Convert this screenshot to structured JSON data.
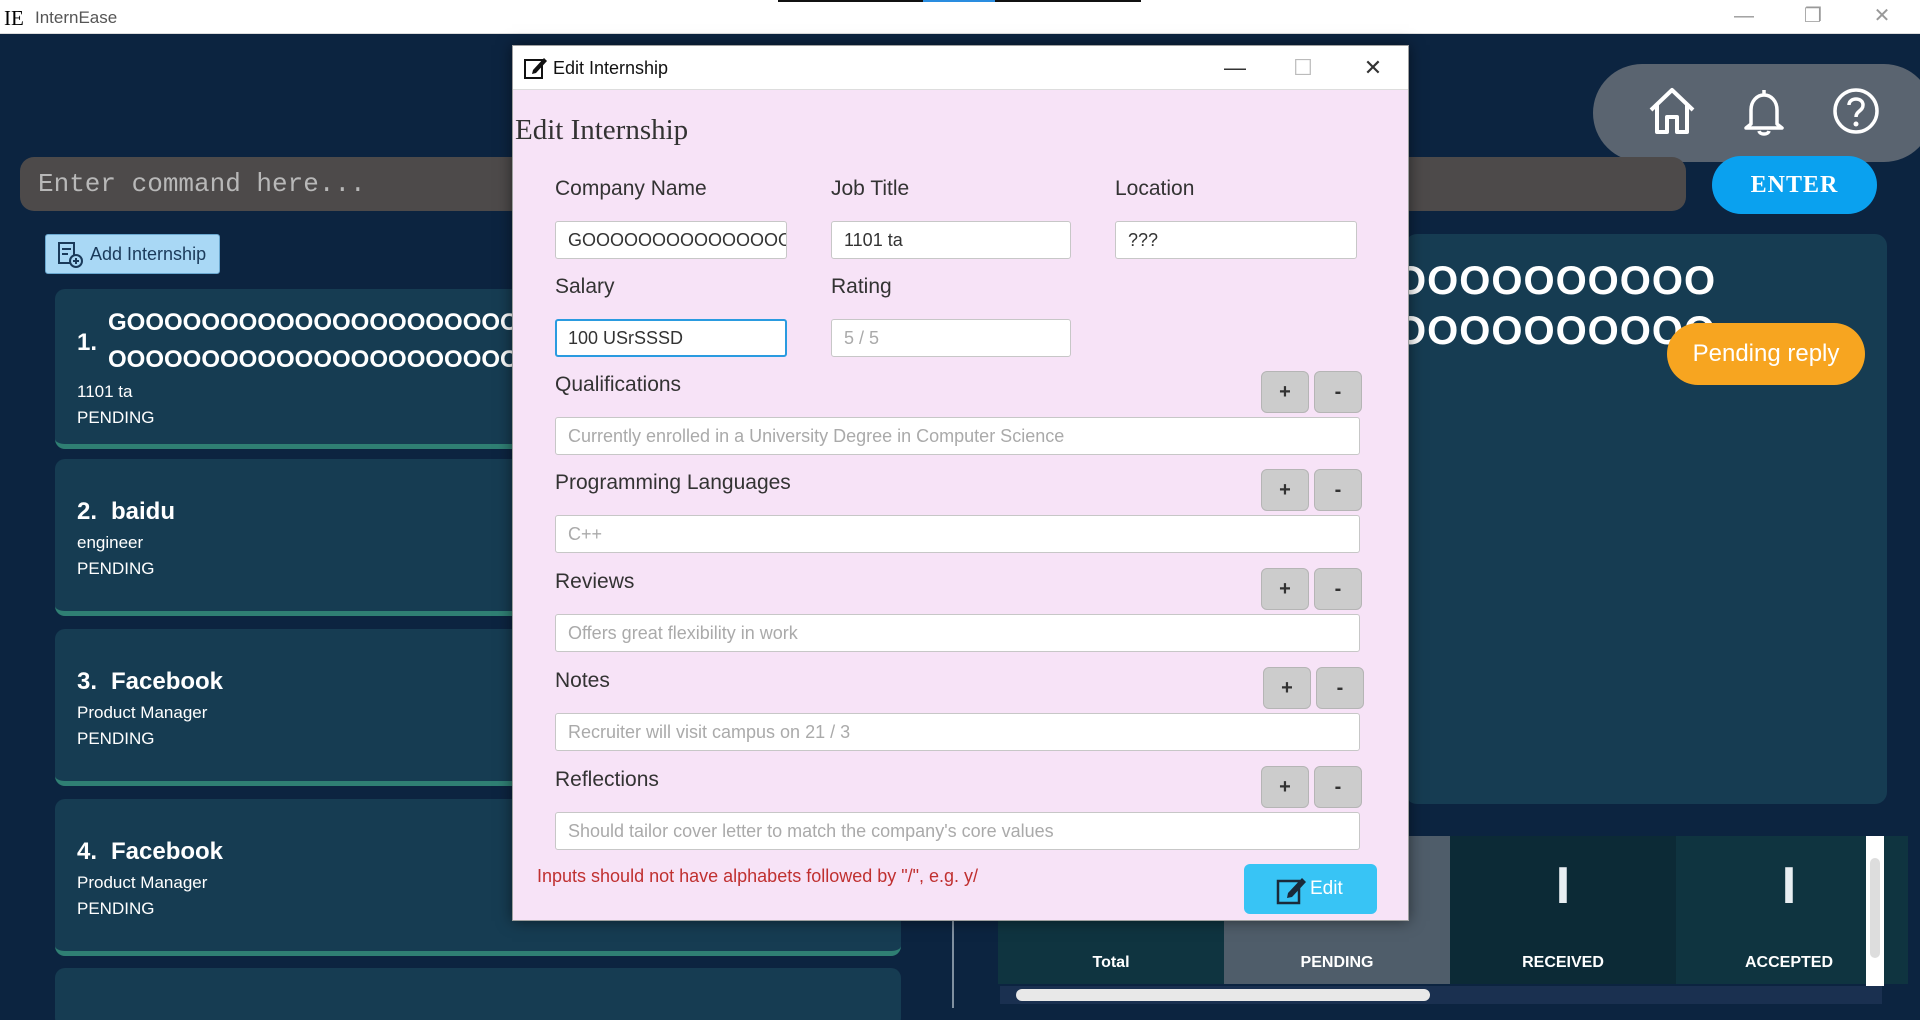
{
  "app": {
    "logo": "IE",
    "title": "InternEase"
  },
  "command": {
    "placeholder": "Enter command here...",
    "enter_label": "ENTER"
  },
  "nav": {
    "icons": [
      "home-icon",
      "bell-icon",
      "help-icon"
    ]
  },
  "add_button": {
    "label": "Add Internship"
  },
  "internships": [
    {
      "index": "1.",
      "company_line1": "GOOOOOOOOOOOOOOOOOOOOOOO",
      "company_line2": "OOOOOOOOOOOOOOOOOOOOOOOO",
      "title": "1101 ta",
      "status": "PENDING"
    },
    {
      "index": "2.",
      "company": "baidu",
      "title": "engineer",
      "status": "PENDING"
    },
    {
      "index": "3.",
      "company": "Facebook",
      "title": "Product  Manager",
      "status": "PENDING"
    },
    {
      "index": "4.",
      "company": "Facebook",
      "title": "Product Manager",
      "status": "PENDING"
    }
  ],
  "detail": {
    "company_line1": "OOOOOOOOOO",
    "company_line2": "OOOOOOOOOO",
    "status_badge": "Pending reply"
  },
  "stats": [
    {
      "label": "Total",
      "value": ""
    },
    {
      "label": "PENDING",
      "value": ""
    },
    {
      "label": "RECEIVED",
      "value": "I"
    },
    {
      "label": "ACCEPTED",
      "value": "I"
    }
  ],
  "dialog": {
    "window_title": "Edit Internship",
    "heading": "Edit Internship",
    "company_name": {
      "label": "Company Name",
      "value": "GOOOOOOOOOOOOOOOOOOOOOOO"
    },
    "job_title": {
      "label": "Job Title",
      "value": "1101 ta"
    },
    "location": {
      "label": "Location",
      "value": "???"
    },
    "salary": {
      "label": "Salary",
      "value": "100 USrSSSD"
    },
    "rating": {
      "label": "Rating",
      "placeholder": "5 / 5"
    },
    "qualifications": {
      "label": "Qualifications",
      "placeholder": "Currently enrolled in a University Degree in Computer Science"
    },
    "programming_languages": {
      "label": "Programming Languages",
      "placeholder": "C++"
    },
    "reviews": {
      "label": "Reviews",
      "placeholder": "Offers great flexibility in work"
    },
    "notes": {
      "label": "Notes",
      "placeholder": "Recruiter will visit campus on 21 / 3"
    },
    "reflections": {
      "label": "Reflections",
      "placeholder": "Should tailor cover letter to match the company's core values"
    },
    "plus": "+",
    "minus": "-",
    "error": "Inputs should not have alphabets followed by \"/\", e.g. y/",
    "edit_label": "Edit"
  },
  "colors": {
    "background": "#0c2440",
    "card": "#163c52",
    "accent": "#0aa1ef",
    "pending": "#f7a520",
    "dialog_bg": "#f7e3f7",
    "error": "#c03030"
  }
}
